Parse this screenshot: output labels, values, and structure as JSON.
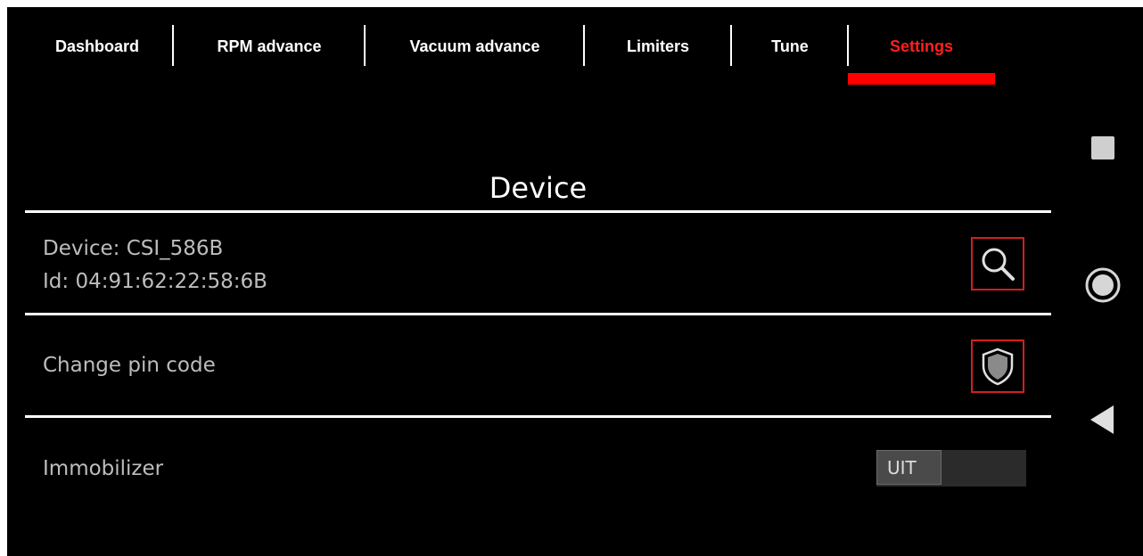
{
  "tabs": [
    {
      "label": "Dashboard",
      "active": false
    },
    {
      "label": "RPM advance",
      "active": false
    },
    {
      "label": "Vacuum advance",
      "active": false
    },
    {
      "label": "Limiters",
      "active": false
    },
    {
      "label": "Tune",
      "active": false
    },
    {
      "label": "Settings",
      "active": true
    }
  ],
  "section": {
    "title": "Device"
  },
  "device": {
    "name_line": "Device: CSI_586B",
    "id_line": "Id: 04:91:62:22:58:6B",
    "search_icon": "search-icon"
  },
  "pin": {
    "label": "Change pin code",
    "icon": "shield-icon"
  },
  "immobilizer": {
    "label": "Immobilizer",
    "toggle_text": "UIT",
    "on": false
  },
  "system_nav": {
    "recents": "square-icon",
    "home": "circle-icon",
    "back": "triangle-back-icon"
  },
  "colors": {
    "accent": "#ff0000",
    "background": "#000000",
    "text": "#bdbdbd"
  }
}
